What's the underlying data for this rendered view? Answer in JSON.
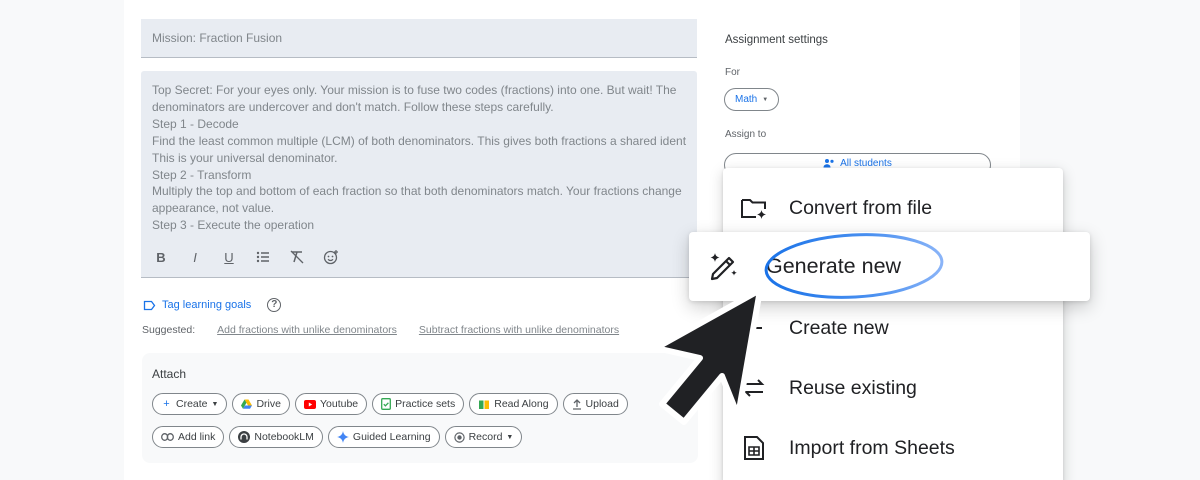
{
  "form": {
    "title_value": "Mission: Fraction Fusion",
    "description_lines": [
      "Top Secret: For your eyes only. Your mission is to fuse two codes (fractions) into one. But wait! The",
      "denominators are undercover and don't match. Follow these steps carefully.",
      "Step 1 - Decode",
      "Find the least common multiple (LCM) of both denominators. This gives both fractions a shared identity.",
      "This is your universal denominator.",
      "Step 2 - Transform",
      "Multiply the top and bottom of each fraction so that both denominators match. Your fractions change",
      "appearance, not value.",
      "Step 3 - Execute the operation"
    ],
    "format_buttons": [
      "B",
      "I",
      "U"
    ],
    "tag_link": "Tag learning goals",
    "suggested_label": "Suggested:",
    "suggestions": [
      "Add fractions with unlike denominators",
      "Subtract fractions with unlike denominators"
    ]
  },
  "attach": {
    "label": "Attach",
    "row1": [
      "Create",
      "Drive",
      "Youtube",
      "Practice sets",
      "Read Along",
      "Upload"
    ],
    "row2": [
      "Add link",
      "NotebookLM",
      "Guided Learning",
      "Record"
    ]
  },
  "settings": {
    "title": "Assignment settings",
    "for_label": "For",
    "subject": "Math",
    "assign_label": "Assign to",
    "assign_value": "All students"
  },
  "menu": {
    "items": [
      "Convert from file",
      "Generate new",
      "Create new",
      "Reuse existing",
      "Import from Sheets"
    ]
  },
  "colors": {
    "accent": "#1a73e8",
    "field_bg": "#e8ecf2",
    "ring_gradient": [
      "#1a73e8",
      "#8ab4f8"
    ]
  }
}
